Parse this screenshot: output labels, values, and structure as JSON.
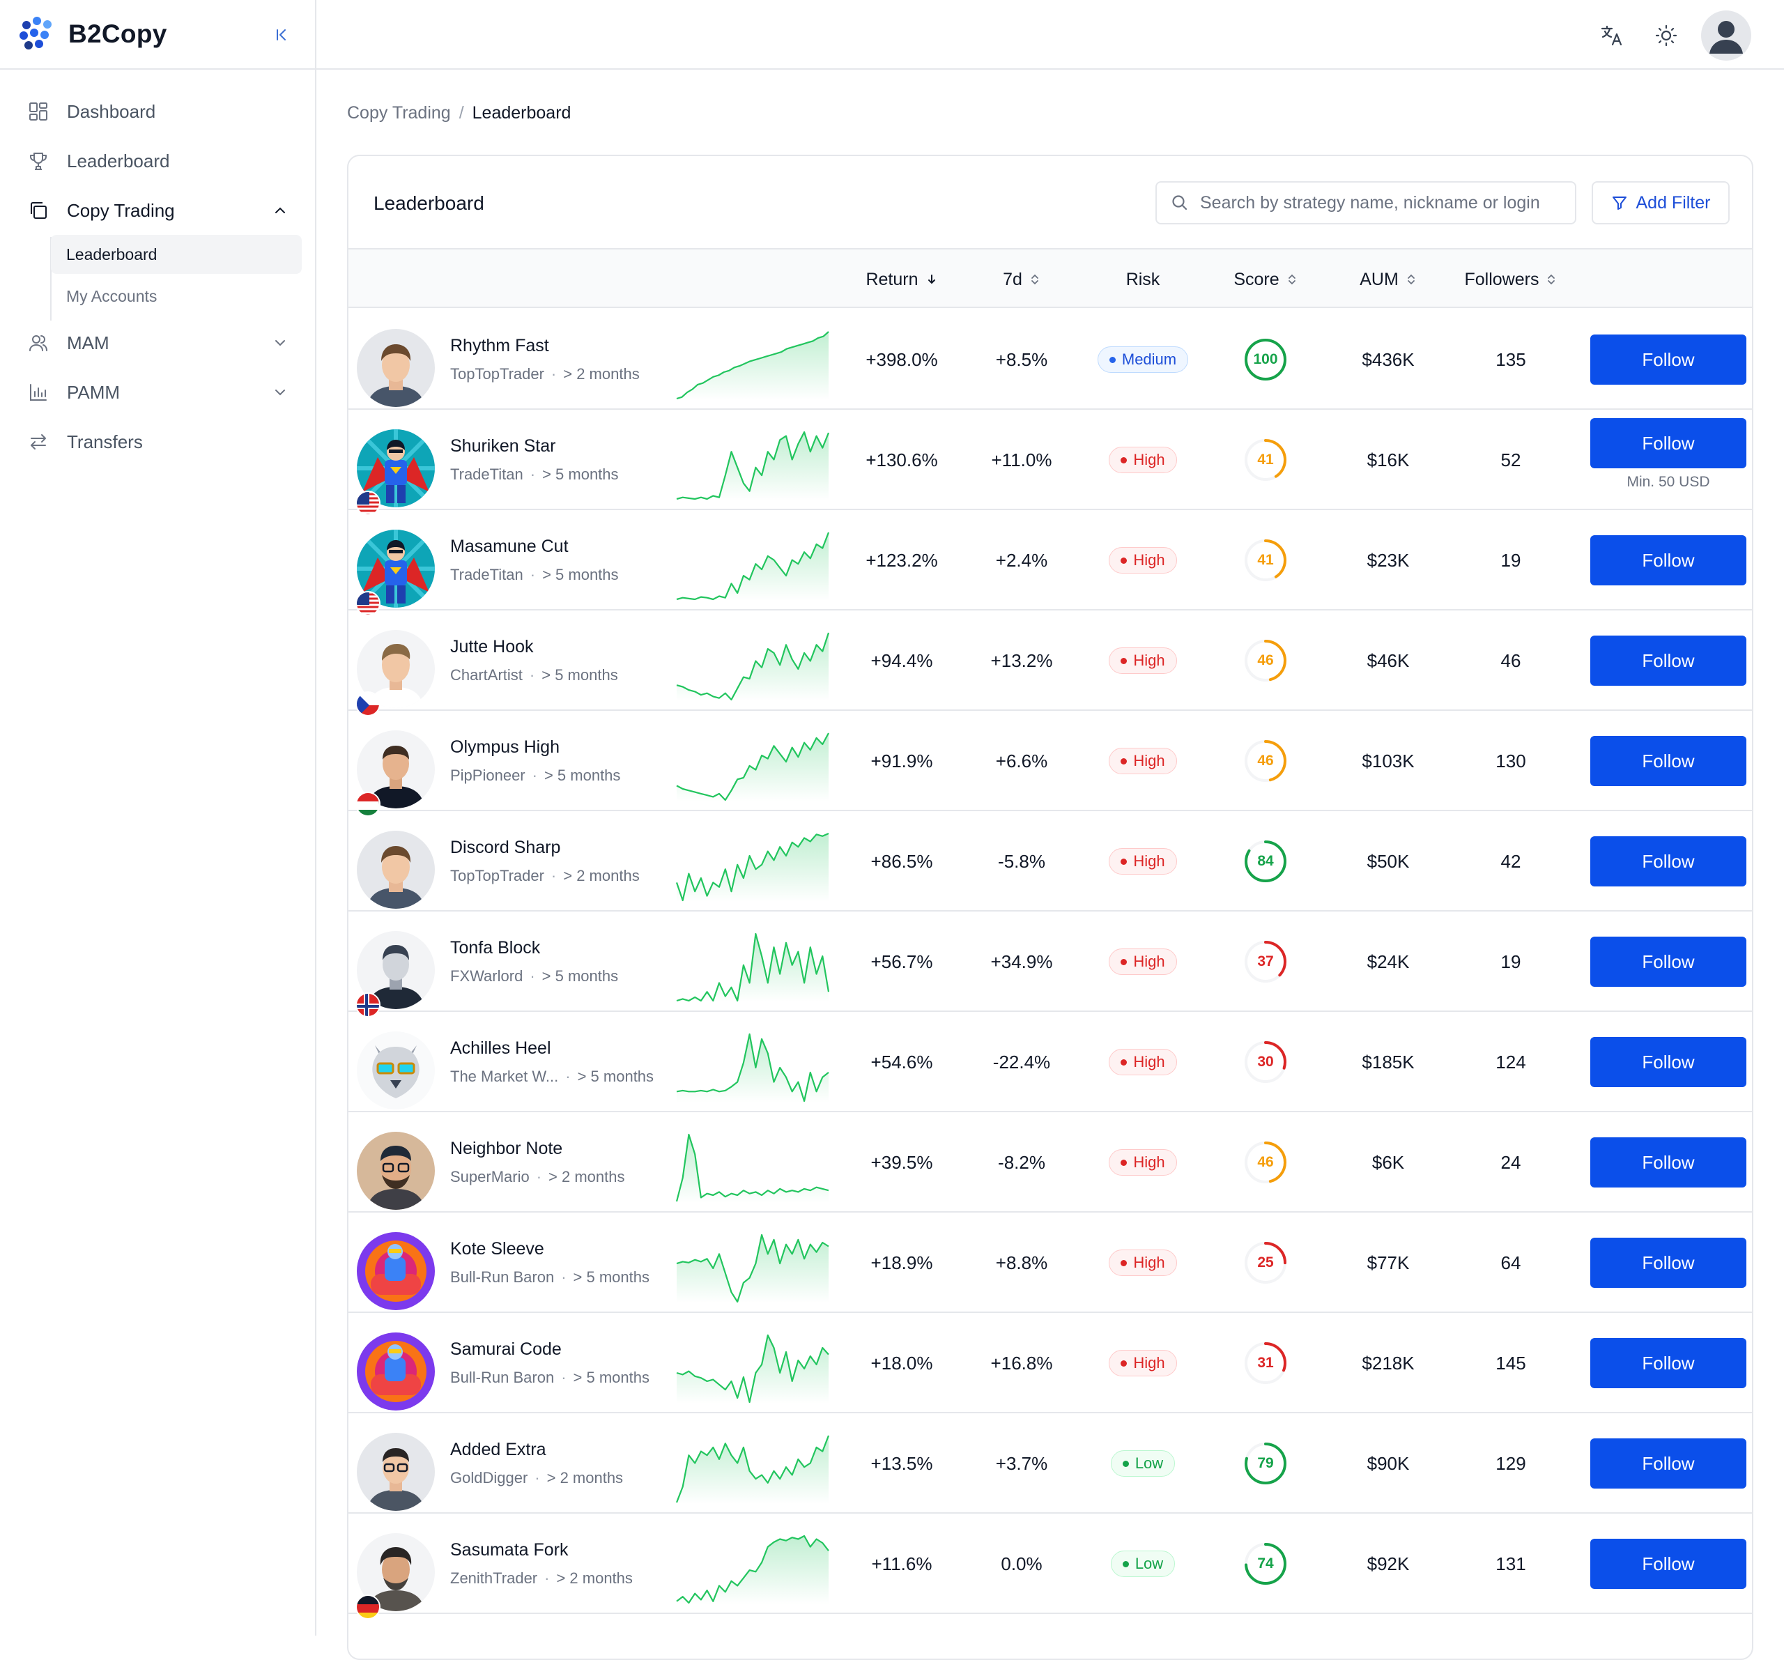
{
  "app": {
    "name": "B2Copy"
  },
  "sidebar": {
    "items": [
      {
        "label": "Dashboard",
        "icon": "dashboard-icon"
      },
      {
        "label": "Leaderboard",
        "icon": "trophy-icon"
      },
      {
        "label": "Copy Trading",
        "icon": "copy-icon",
        "expanded": true
      },
      {
        "label": "MAM",
        "icon": "users-icon"
      },
      {
        "label": "PAMM",
        "icon": "bar-chart-icon"
      },
      {
        "label": "Transfers",
        "icon": "transfer-icon"
      }
    ],
    "submenu": [
      {
        "label": "Leaderboard",
        "active": true
      },
      {
        "label": "My Accounts",
        "active": false
      }
    ]
  },
  "topbar": {
    "icons": [
      "translate-icon",
      "theme-sun-icon",
      "user-avatar"
    ]
  },
  "breadcrumb": {
    "parent": "Copy Trading",
    "separator": "/",
    "current": "Leaderboard"
  },
  "card": {
    "title": "Leaderboard",
    "search_placeholder": "Search by strategy name, nickname or login",
    "filter_label": "Add Filter"
  },
  "columns": {
    "return": "Return",
    "d7": "7d",
    "risk": "Risk",
    "score": "Score",
    "aum": "AUM",
    "followers": "Followers"
  },
  "colors": {
    "accent": "#0b4fea",
    "positive": "#22c55e",
    "high": "#dc2626",
    "medium": "#2563eb",
    "score_green": "#16a34a",
    "score_amber": "#f59e0b",
    "score_red": "#dc2626"
  },
  "follow_label": "Follow",
  "rows": [
    {
      "name": "Rhythm Fast",
      "nick": "TopTopTrader",
      "age": "> 2 months",
      "ret": "+398.0%",
      "d7": "+8.5%",
      "risk": "Medium",
      "risk_level": "med",
      "score": "100",
      "score_frac": 1.0,
      "score_color": "#16a34a",
      "aum": "$436K",
      "followers": "135",
      "avatar": "man-short-hair",
      "flag": "",
      "note": "",
      "spark": [
        10,
        12,
        18,
        22,
        28,
        30,
        34,
        38,
        40,
        44,
        46,
        50,
        52,
        55,
        58,
        60,
        62,
        64,
        66,
        68,
        70,
        74,
        76,
        78,
        80,
        82,
        84,
        88,
        90,
        96
      ]
    },
    {
      "name": "Shuriken Star",
      "nick": "TradeTitan",
      "age": "> 5 months",
      "ret": "+130.6%",
      "d7": "+11.0%",
      "risk": "High",
      "risk_level": "high",
      "score": "41",
      "score_frac": 0.41,
      "score_color": "#f59e0b",
      "aum": "$16K",
      "followers": "52",
      "avatar": "superhero",
      "flag": "us",
      "note": "Min. 50 USD",
      "spark": [
        10,
        12,
        11,
        10,
        12,
        10,
        14,
        12,
        40,
        70,
        50,
        30,
        20,
        50,
        40,
        70,
        60,
        85,
        90,
        60,
        80,
        95,
        70,
        90,
        75,
        94
      ]
    },
    {
      "name": "Masamune Cut",
      "nick": "TradeTitan",
      "age": "> 5 months",
      "ret": "+123.2%",
      "d7": "+2.4%",
      "risk": "High",
      "risk_level": "high",
      "score": "41",
      "score_frac": 0.41,
      "score_color": "#f59e0b",
      "aum": "$23K",
      "followers": "19",
      "avatar": "superhero",
      "flag": "us",
      "note": "",
      "spark": [
        10,
        12,
        11,
        10,
        13,
        12,
        10,
        14,
        12,
        30,
        18,
        40,
        35,
        55,
        48,
        65,
        60,
        50,
        40,
        60,
        55,
        70,
        62,
        80,
        75,
        95
      ]
    },
    {
      "name": "Jutte Hook",
      "nick": "ChartArtist",
      "age": "> 5 months",
      "ret": "+94.4%",
      "d7": "+13.2%",
      "risk": "High",
      "risk_level": "high",
      "score": "46",
      "score_frac": 0.46,
      "score_color": "#f59e0b",
      "aum": "$46K",
      "followers": "46",
      "avatar": "man-blond",
      "flag": "cz",
      "note": "",
      "spark": [
        30,
        28,
        24,
        22,
        18,
        20,
        16,
        14,
        20,
        12,
        26,
        40,
        38,
        60,
        52,
        75,
        70,
        55,
        80,
        62,
        50,
        70,
        60,
        80,
        72,
        95
      ]
    },
    {
      "name": "Olympus High",
      "nick": "PipPioneer",
      "age": "> 5 months",
      "ret": "+91.9%",
      "d7": "+6.6%",
      "risk": "High",
      "risk_level": "high",
      "score": "46",
      "score_frac": 0.46,
      "score_color": "#f59e0b",
      "aum": "$103K",
      "followers": "130",
      "avatar": "man-dark-shirt",
      "flag": "hu",
      "note": "",
      "spark": [
        30,
        26,
        24,
        22,
        20,
        18,
        16,
        20,
        12,
        24,
        38,
        40,
        55,
        50,
        68,
        64,
        80,
        70,
        60,
        78,
        66,
        84,
        75,
        90,
        82,
        96
      ]
    },
    {
      "name": "Discord Sharp",
      "nick": "TopTopTrader",
      "age": "> 2 months",
      "ret": "+86.5%",
      "d7": "-5.8%",
      "risk": "High",
      "risk_level": "high",
      "score": "84",
      "score_frac": 0.84,
      "score_color": "#16a34a",
      "aum": "$50K",
      "followers": "42",
      "avatar": "man-short-hair",
      "flag": "",
      "note": "",
      "spark": [
        40,
        20,
        50,
        30,
        45,
        25,
        40,
        35,
        55,
        30,
        60,
        45,
        70,
        55,
        60,
        75,
        65,
        80,
        70,
        85,
        80,
        90,
        86,
        94,
        92,
        95
      ]
    },
    {
      "name": "Tonfa Block",
      "nick": "FXWarlord",
      "age": "> 5 months",
      "ret": "+56.7%",
      "d7": "+34.9%",
      "risk": "High",
      "risk_level": "high",
      "score": "37",
      "score_frac": 0.37,
      "score_color": "#dc2626",
      "aum": "$24K",
      "followers": "19",
      "avatar": "man-bw",
      "flag": "no",
      "note": "",
      "spark": [
        20,
        22,
        20,
        24,
        20,
        30,
        20,
        40,
        25,
        35,
        20,
        60,
        40,
        95,
        70,
        40,
        80,
        50,
        85,
        60,
        75,
        40,
        80,
        50,
        70,
        30
      ]
    },
    {
      "name": "Achilles Heel",
      "nick": "The Market W...",
      "age": "> 5 months",
      "ret": "+54.6%",
      "d7": "-22.4%",
      "risk": "High",
      "risk_level": "high",
      "score": "30",
      "score_frac": 0.3,
      "score_color": "#dc2626",
      "aum": "$185K",
      "followers": "124",
      "avatar": "wolf",
      "flag": "",
      "note": "",
      "spark": [
        30,
        31,
        30,
        30,
        31,
        30,
        32,
        30,
        31,
        35,
        40,
        60,
        90,
        55,
        85,
        70,
        40,
        55,
        45,
        30,
        40,
        20,
        50,
        30,
        45,
        50
      ]
    },
    {
      "name": "Neighbor Note",
      "nick": "SuperMario",
      "age": "> 2 months",
      "ret": "+39.5%",
      "d7": "-8.2%",
      "risk": "High",
      "risk_level": "high",
      "score": "46",
      "score_frac": 0.46,
      "score_color": "#f59e0b",
      "aum": "$6K",
      "followers": "24",
      "avatar": "man-glasses-beard",
      "flag": "",
      "note": "",
      "spark": [
        10,
        40,
        95,
        70,
        15,
        20,
        18,
        22,
        16,
        20,
        18,
        24,
        20,
        22,
        18,
        24,
        20,
        26,
        22,
        24,
        22,
        26,
        24,
        28,
        26,
        24
      ]
    },
    {
      "name": "Kote Sleeve",
      "nick": "Bull-Run Baron",
      "age": "> 5 months",
      "ret": "+18.9%",
      "d7": "+8.8%",
      "risk": "High",
      "risk_level": "high",
      "score": "25",
      "score_frac": 0.25,
      "score_color": "#dc2626",
      "aum": "$77K",
      "followers": "64",
      "avatar": "cartoon-bull",
      "flag": "",
      "note": "",
      "spark": [
        60,
        62,
        61,
        64,
        62,
        65,
        55,
        70,
        50,
        30,
        20,
        40,
        45,
        60,
        90,
        70,
        85,
        60,
        80,
        70,
        85,
        65,
        80,
        72,
        82,
        78
      ]
    },
    {
      "name": "Samurai Code",
      "nick": "Bull-Run Baron",
      "age": "> 5 months",
      "ret": "+18.0%",
      "d7": "+16.8%",
      "risk": "High",
      "risk_level": "high",
      "score": "31",
      "score_frac": 0.31,
      "score_color": "#dc2626",
      "aum": "$218K",
      "followers": "145",
      "avatar": "cartoon-bull",
      "flag": "",
      "note": "",
      "spark": [
        50,
        48,
        52,
        46,
        44,
        40,
        42,
        36,
        30,
        40,
        20,
        45,
        15,
        50,
        60,
        95,
        80,
        50,
        75,
        40,
        65,
        55,
        70,
        60,
        80,
        72
      ]
    },
    {
      "name": "Added Extra",
      "nick": "GoldDigger",
      "age": "> 2 months",
      "ret": "+13.5%",
      "d7": "+3.7%",
      "risk": "Low",
      "risk_level": "low",
      "score": "79",
      "score_frac": 0.79,
      "score_color": "#16a34a",
      "aum": "$90K",
      "followers": "129",
      "avatar": "man-glasses",
      "flag": "",
      "note": "",
      "spark": [
        10,
        30,
        70,
        60,
        75,
        70,
        80,
        65,
        85,
        70,
        60,
        80,
        50,
        40,
        45,
        35,
        50,
        40,
        55,
        45,
        65,
        55,
        60,
        80,
        75,
        95
      ]
    },
    {
      "name": "Sasumata Fork",
      "nick": "ZenithTrader",
      "age": "> 2 months",
      "ret": "+11.6%",
      "d7": "0.0%",
      "risk": "Low",
      "risk_level": "low",
      "score": "74",
      "score_frac": 0.74,
      "score_color": "#16a34a",
      "aum": "$92K",
      "followers": "131",
      "avatar": "man-curly",
      "flag": "de",
      "note": "",
      "spark": [
        10,
        16,
        8,
        20,
        12,
        24,
        10,
        30,
        22,
        36,
        30,
        40,
        50,
        48,
        60,
        80,
        86,
        90,
        88,
        92,
        90,
        94,
        80,
        90,
        85,
        75
      ]
    }
  ]
}
